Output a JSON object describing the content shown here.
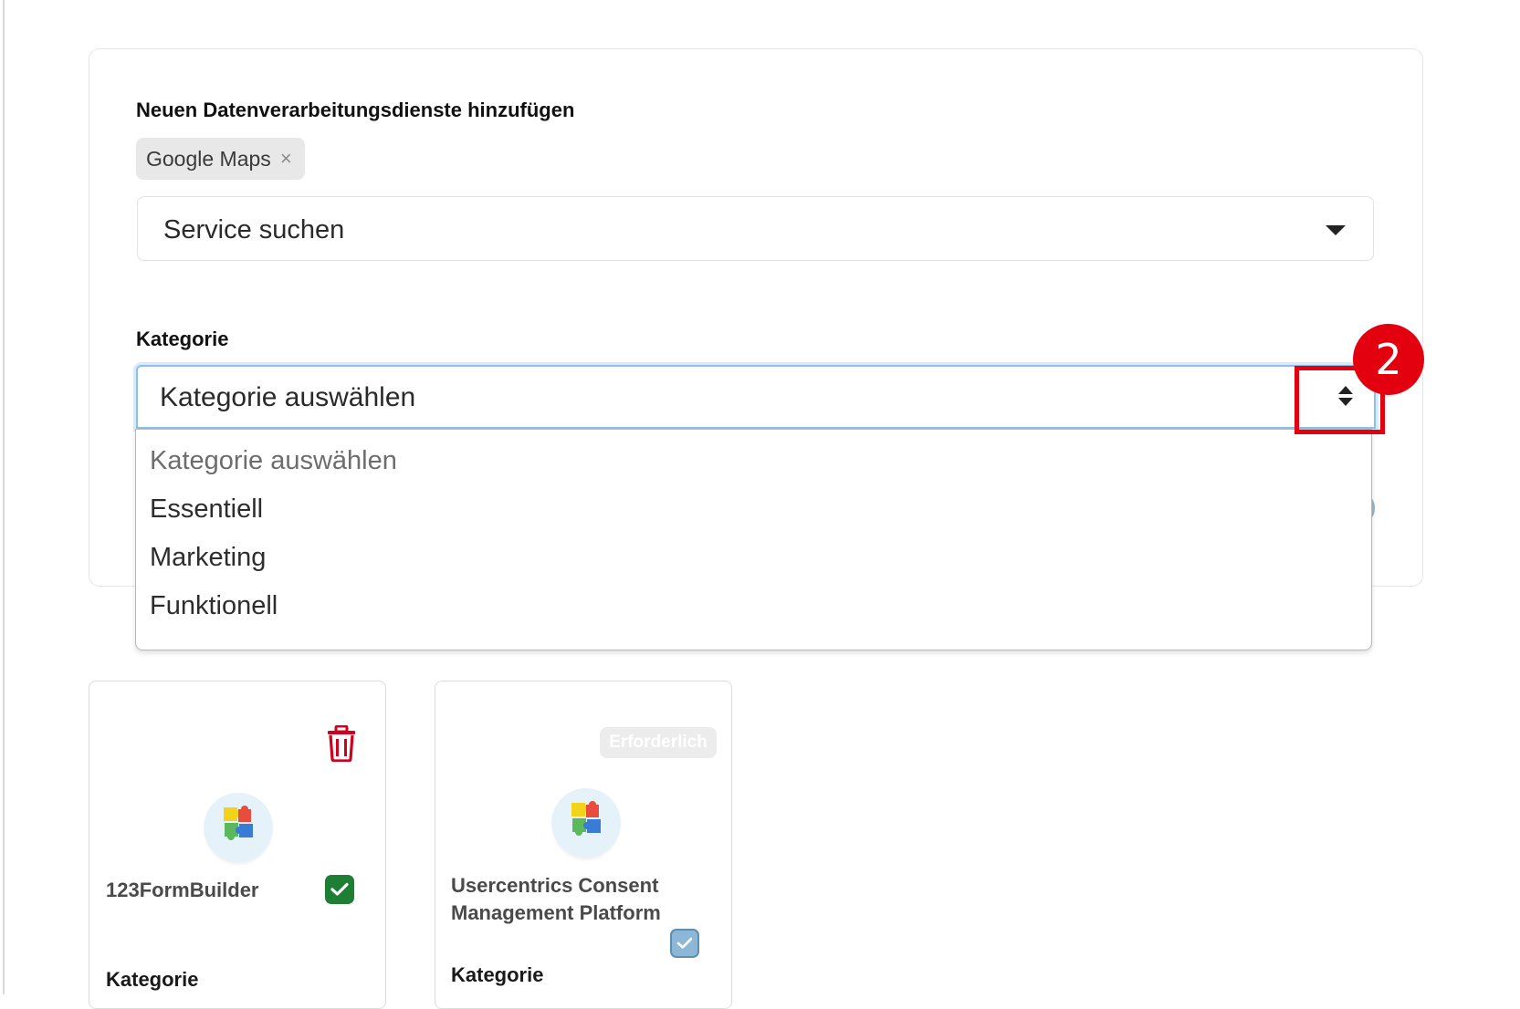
{
  "form": {
    "add_service_label": "Neuen Datenverarbeitungsdienste hinzufügen",
    "selected_chip": "Google Maps",
    "chip_remove": "×",
    "service_search_placeholder": "Service suchen",
    "category_label": "Kategorie",
    "category_select_value": "Kategorie auswählen",
    "category_options": [
      "Kategorie auswählen",
      "Essentiell",
      "Marketing",
      "Funktionell"
    ]
  },
  "annotation": {
    "step_number": "2",
    "color": "#e3000f"
  },
  "cards": [
    {
      "name": "123FormBuilder",
      "category_label": "Kategorie",
      "action_icon": "trash-icon",
      "checked": true
    },
    {
      "name": "Usercentrics Consent Management Platform",
      "category_label": "Kategorie",
      "badge": "Erforderlich",
      "checked": true
    }
  ],
  "colors": {
    "focus_border": "#8cc0ea",
    "check_green": "#1e7e34",
    "check_blue": "#8db7d6",
    "trash_red": "#d0021b"
  }
}
